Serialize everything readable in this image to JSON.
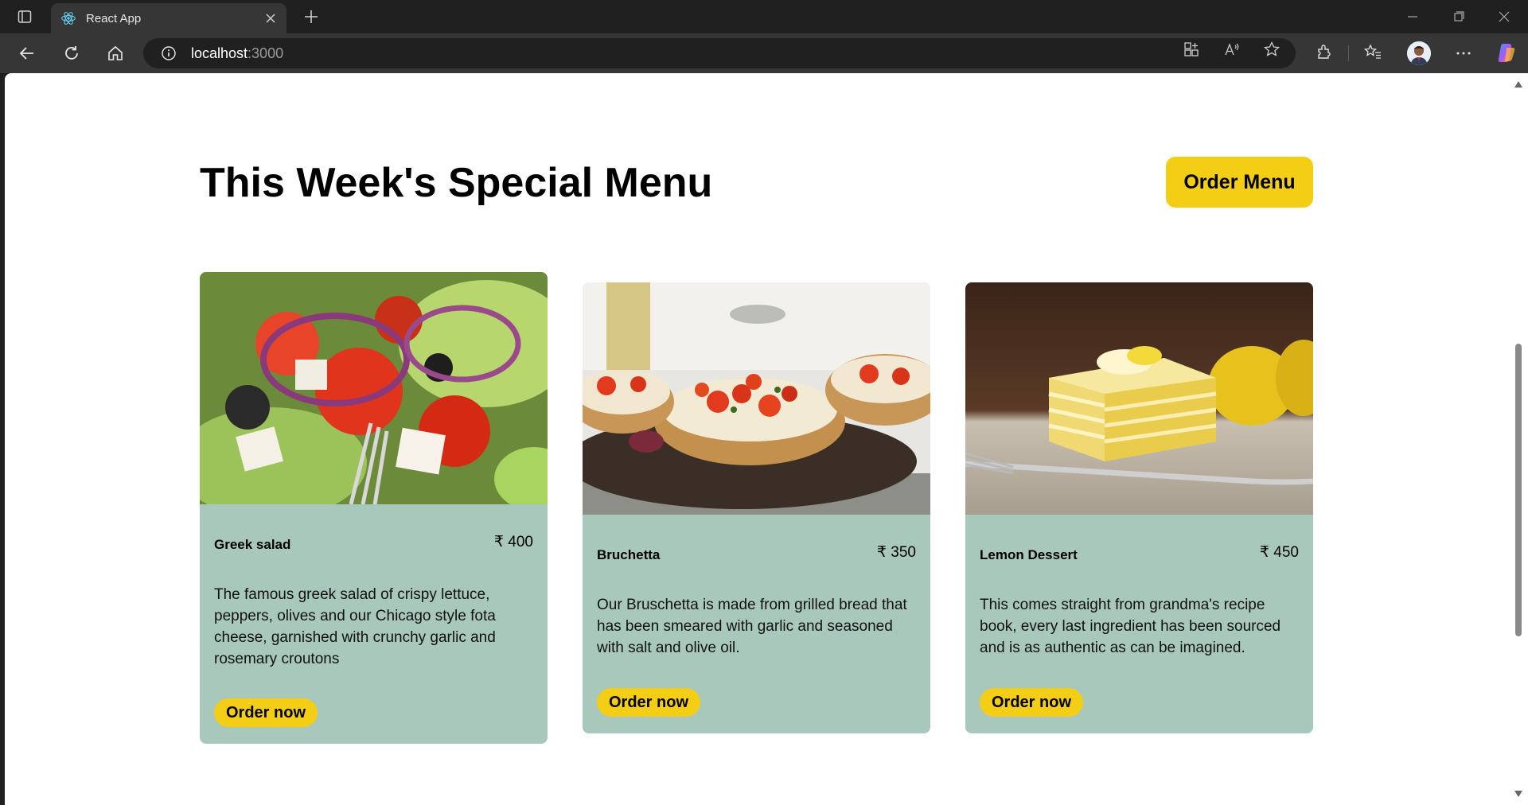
{
  "browser": {
    "tab_title": "React App",
    "url_host": "localhost",
    "url_port": ":3000"
  },
  "page": {
    "heading": "This Week's Special Menu",
    "order_menu_label": "Order Menu",
    "cards": [
      {
        "name": "Greek salad",
        "price": "₹ 400",
        "description": "The famous greek salad of crispy lettuce, peppers, olives and our Chicago style fota cheese, garnished with crunchy garlic and rosemary croutons",
        "button": "Order now"
      },
      {
        "name": "Bruchetta",
        "price": "₹ 350",
        "description": "Our Bruschetta is made from grilled bread that has been smeared with garlic and seasoned with salt and olive oil.",
        "button": "Order now"
      },
      {
        "name": "Lemon Dessert",
        "price": "₹ 450",
        "description": "This comes straight from grandma's recipe book, every last ingredient has been sourced and is as authentic as can be imagined.",
        "button": "Order now"
      }
    ]
  },
  "colors": {
    "accent_yellow": "#f4ce14",
    "card_green": "#a8c8bc"
  }
}
